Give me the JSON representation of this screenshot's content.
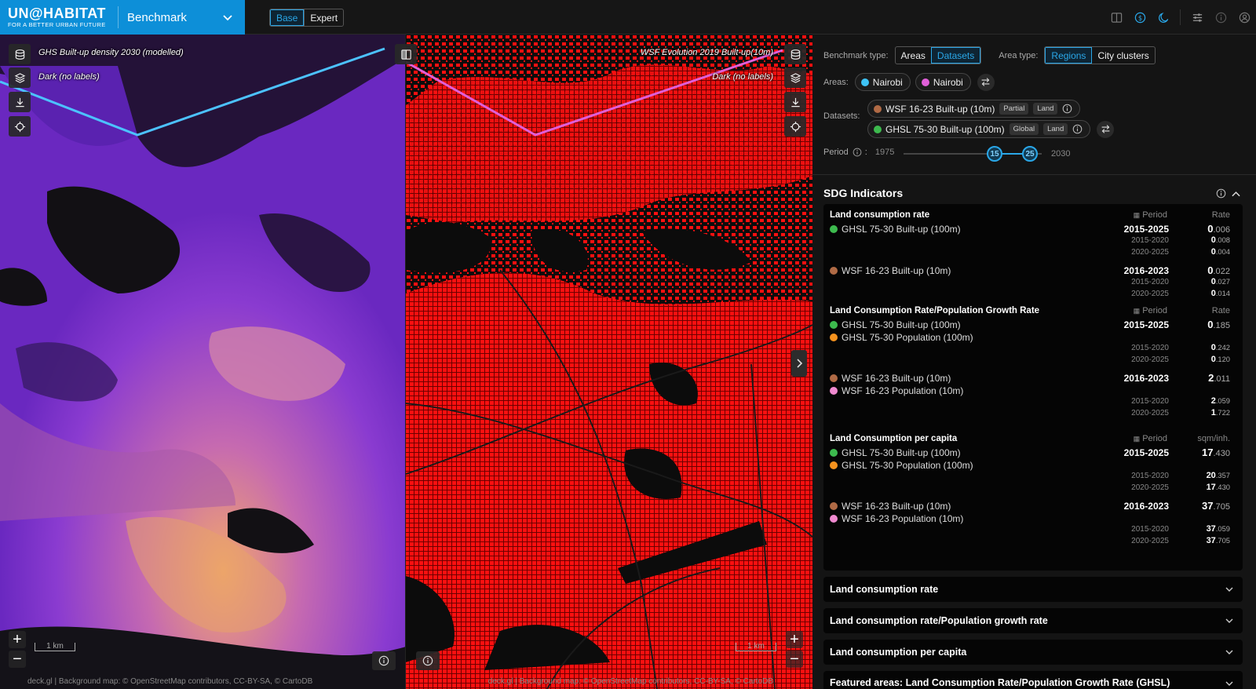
{
  "app": {
    "logo_line1": "UN@HABITAT",
    "logo_line2": "FOR A BETTER URBAN FUTURE",
    "title": "Benchmark",
    "modes": [
      "Base",
      "Expert"
    ],
    "active_mode": "Base"
  },
  "maps": {
    "left": {
      "layer": "GHS Built-up density 2030 (modelled)",
      "basemap": "Dark (no labels)",
      "scale": "1 km"
    },
    "right": {
      "layer": "WSF Evolution 2019 Built-up(10m)",
      "basemap": "Dark (no labels)",
      "scale": "1 km"
    },
    "attribution": "deck.gl | Background map: © OpenStreetMap contributors, CC-BY-SA, © CartoDB"
  },
  "panel": {
    "benchmark_type_label": "Benchmark type:",
    "benchmark_types": [
      "Areas",
      "Datasets"
    ],
    "active_benchmark_type": "Datasets",
    "area_type_label": "Area type:",
    "area_types": [
      "Regions",
      "City clusters"
    ],
    "active_area_type": "Regions",
    "areas_label": "Areas:",
    "areas": [
      {
        "name": "Nairobi",
        "color": "#3ec3f5"
      },
      {
        "name": "Nairobi",
        "color": "#e05fd8"
      }
    ],
    "datasets_label": "Datasets:",
    "datasets": [
      {
        "name": "WSF 16-23 Built-up (10m)",
        "color": "#b06a45",
        "tags": [
          "Partial",
          "Land"
        ]
      },
      {
        "name": "GHSL 75-30 Built-up (100m)",
        "color": "#3dba4e",
        "tags": [
          "Global",
          "Land"
        ]
      }
    ],
    "period_label": "Period",
    "period_min": "1975",
    "period_max": "2030",
    "period_from": "15",
    "period_to": "25"
  },
  "sdg": {
    "title": "SDG Indicators",
    "period_header": "Period",
    "indicators": [
      {
        "title": "Land consumption rate",
        "unit": "Rate",
        "groups": [
          {
            "datasets": [
              {
                "name": "GHSL 75-30 Built-up (100m)",
                "color": "#3dba4e"
              }
            ],
            "period": "2015-2025",
            "int": "0",
            "dec": ".006",
            "sub": [
              {
                "period": "2015-2020",
                "int": "0",
                "dec": ".008"
              },
              {
                "period": "2020-2025",
                "int": "0",
                "dec": ".004"
              }
            ]
          },
          {
            "datasets": [
              {
                "name": "WSF 16-23 Built-up (10m)",
                "color": "#b06a45"
              }
            ],
            "period": "2016-2023",
            "int": "0",
            "dec": ".022",
            "sub": [
              {
                "period": "2015-2020",
                "int": "0",
                "dec": ".027"
              },
              {
                "period": "2020-2025",
                "int": "0",
                "dec": ".014"
              }
            ]
          }
        ]
      },
      {
        "title": "Land Consumption Rate/Population Growth Rate",
        "unit": "Rate",
        "groups": [
          {
            "datasets": [
              {
                "name": "GHSL 75-30 Built-up (100m)",
                "color": "#3dba4e"
              },
              {
                "name": "GHSL 75-30 Population (100m)",
                "color": "#f5921e"
              }
            ],
            "period": "2015-2025",
            "int": "0",
            "dec": ".185",
            "sub": [
              {
                "period": "2015-2020",
                "int": "0",
                "dec": ".242"
              },
              {
                "period": "2020-2025",
                "int": "0",
                "dec": ".120"
              }
            ]
          },
          {
            "datasets": [
              {
                "name": "WSF 16-23 Built-up (10m)",
                "color": "#b06a45"
              },
              {
                "name": "WSF 16-23 Population (10m)",
                "color": "#f08ad0"
              }
            ],
            "period": "2016-2023",
            "int": "2",
            "dec": ".011",
            "sub": [
              {
                "period": "2015-2020",
                "int": "2",
                "dec": ".059"
              },
              {
                "period": "2020-2025",
                "int": "1",
                "dec": ".722"
              }
            ]
          }
        ]
      },
      {
        "title": "Land Consumption per capita",
        "unit": "sqm/inh.",
        "groups": [
          {
            "datasets": [
              {
                "name": "GHSL 75-30 Built-up (100m)",
                "color": "#3dba4e"
              },
              {
                "name": "GHSL 75-30 Population (100m)",
                "color": "#f5921e"
              }
            ],
            "period": "2015-2025",
            "int": "17",
            "dec": ".430",
            "sub": [
              {
                "period": "2015-2020",
                "int": "20",
                "dec": ".357"
              },
              {
                "period": "2020-2025",
                "int": "17",
                "dec": ".430"
              }
            ]
          },
          {
            "datasets": [
              {
                "name": "WSF 16-23 Built-up (10m)",
                "color": "#b06a45"
              },
              {
                "name": "WSF 16-23 Population (10m)",
                "color": "#f08ad0"
              }
            ],
            "period": "2016-2023",
            "int": "37",
            "dec": ".705",
            "sub": [
              {
                "period": "2015-2020",
                "int": "37",
                "dec": ".059"
              },
              {
                "period": "2020-2025",
                "int": "37",
                "dec": ".705"
              }
            ]
          }
        ]
      }
    ]
  },
  "accordions": [
    "Land consumption rate",
    "Land consumption rate/Population growth rate",
    "Land consumption per capita",
    "Featured areas: Land Consumption Rate/Population Growth Rate (GHSL)"
  ],
  "colors": {
    "accent": "#2aa7e8",
    "brand": "#0d8fd8",
    "wsf_built": "#ff1010"
  }
}
